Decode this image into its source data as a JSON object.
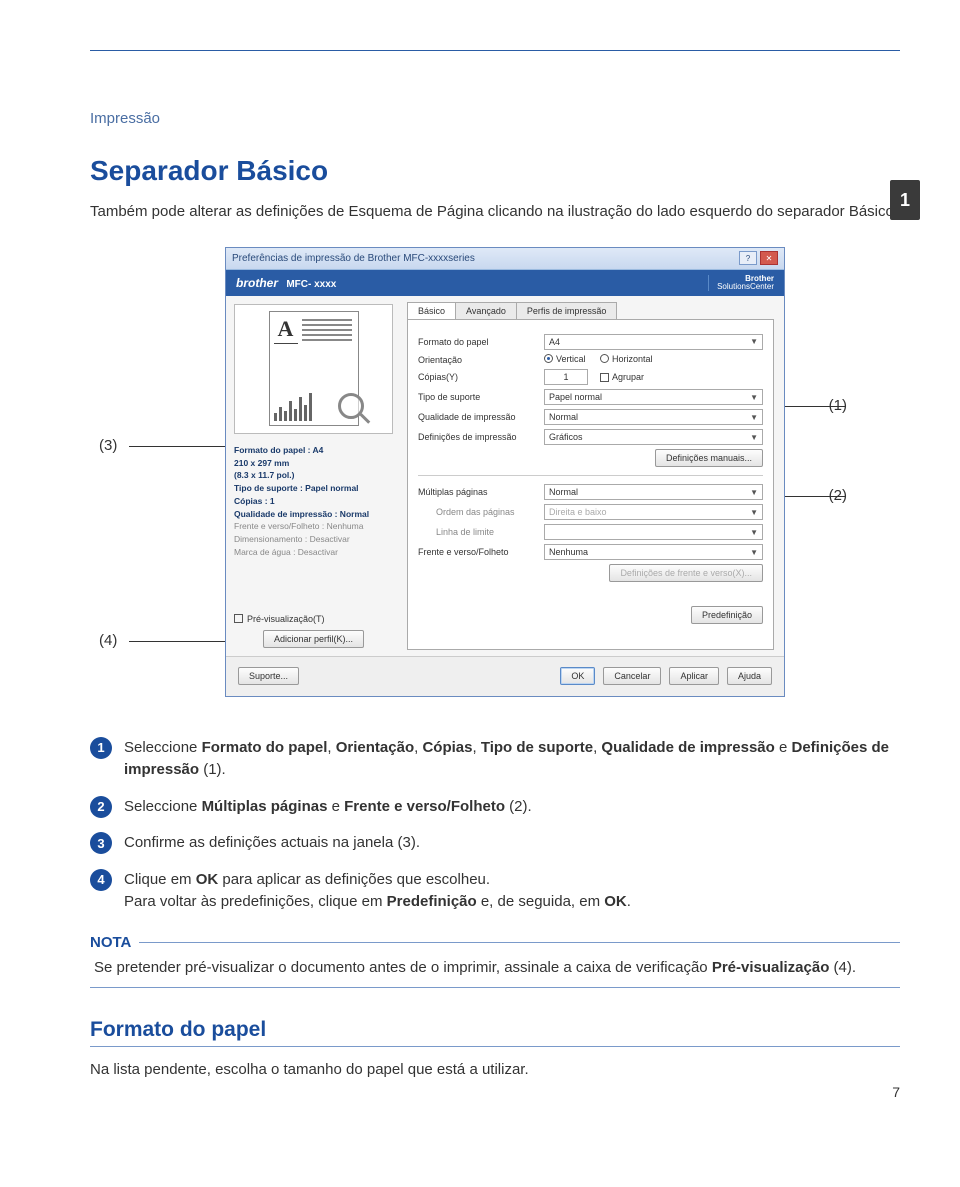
{
  "breadcrumb": "Impressão",
  "title": "Separador Básico",
  "intro": "Também pode alterar as definições de Esquema de Página clicando na ilustração do lado esquerdo do separador Básico.",
  "side_tab": "1",
  "page_number": "7",
  "callouts": {
    "c1": "(1)",
    "c2": "(2)",
    "c3": "(3)",
    "c4": "(4)"
  },
  "dialog": {
    "title": "Preferências de impressão de Brother MFC-xxxxseries",
    "brand": "brother",
    "model": "MFC- xxxx",
    "solutions_l1": "Brother",
    "solutions_l2": "SolutionsCenter",
    "winbtn_help": "?",
    "winbtn_close": "✕",
    "tabs": [
      "Básico",
      "Avançado",
      "Perfis de impressão"
    ],
    "summary": {
      "s1": "Formato do papel : A4",
      "s2": "210 x 297 mm",
      "s3": "(8.3 x 11.7 pol.)",
      "s4": "Tipo de suporte : Papel normal",
      "s5": "Cópias : 1",
      "s6": "Qualidade de impressão : Normal",
      "s7": "Frente e verso/Folheto : Nenhuma",
      "s8": "Dimensionamento : Desactivar",
      "s9": "Marca de água : Desactivar"
    },
    "fields": {
      "formato_lbl": "Formato do papel",
      "formato_val": "A4",
      "orient_lbl": "Orientação",
      "orient_v": "Vertical",
      "orient_h": "Horizontal",
      "copias_lbl": "Cópias(Y)",
      "copias_val": "1",
      "agrupar": "Agrupar",
      "tipo_lbl": "Tipo de suporte",
      "tipo_val": "Papel normal",
      "qual_lbl": "Qualidade de impressão",
      "qual_val": "Normal",
      "defimp_lbl": "Definições de impressão",
      "defimp_val": "Gráficos",
      "defman_btn": "Definições manuais...",
      "mult_lbl": "Múltiplas páginas",
      "mult_val": "Normal",
      "ordem_lbl": "Ordem das páginas",
      "ordem_val": "Direita e baixo",
      "linha_lbl": "Linha de limite",
      "linha_val": "",
      "fv_lbl": "Frente e verso/Folheto",
      "fv_val": "Nenhuma",
      "deffv_btn": "Definições de frente e verso(X)..."
    },
    "left": {
      "prev_label": "Pré-visualização(T)",
      "addperfil": "Adicionar perfil(K)...",
      "suporte": "Suporte..."
    },
    "footer": {
      "predef": "Predefinição",
      "ok": "OK",
      "cancel": "Cancelar",
      "apply": "Aplicar",
      "help": "Ajuda"
    }
  },
  "steps": {
    "s1_a": "Seleccione ",
    "s1_b1": "Formato do papel",
    "s1_t1": ", ",
    "s1_b2": "Orientação",
    "s1_t2": ", ",
    "s1_b3": "Cópias",
    "s1_t3": ", ",
    "s1_b4": "Tipo de suporte",
    "s1_t4": ", ",
    "s1_b5": "Qualidade de impressão",
    "s1_t5": " e ",
    "s1_b6": "Definições de impressão",
    "s1_t6": " (1).",
    "s2_a": "Seleccione ",
    "s2_b1": "Múltiplas páginas",
    "s2_t1": " e ",
    "s2_b2": "Frente e verso/Folheto",
    "s2_t2": " (2).",
    "s3": "Confirme as definições actuais na janela (3).",
    "s4_a": "Clique em ",
    "s4_b1": "OK",
    "s4_t1": " para aplicar as definições que escolheu.",
    "s4_l2a": "Para voltar às predefinições, clique em ",
    "s4_b2": "Predefinição",
    "s4_t2": " e, de seguida, em ",
    "s4_b3": "OK",
    "s4_t3": "."
  },
  "nota": {
    "label": "NOTA",
    "body_a": "Se pretender pré-visualizar o documento antes de o imprimir, assinale a caixa de verificação ",
    "body_b": "Pré-visualização",
    "body_c": " (4)."
  },
  "h2": "Formato do papel",
  "h2_body": "Na lista pendente, escolha o tamanho do papel que está a utilizar."
}
